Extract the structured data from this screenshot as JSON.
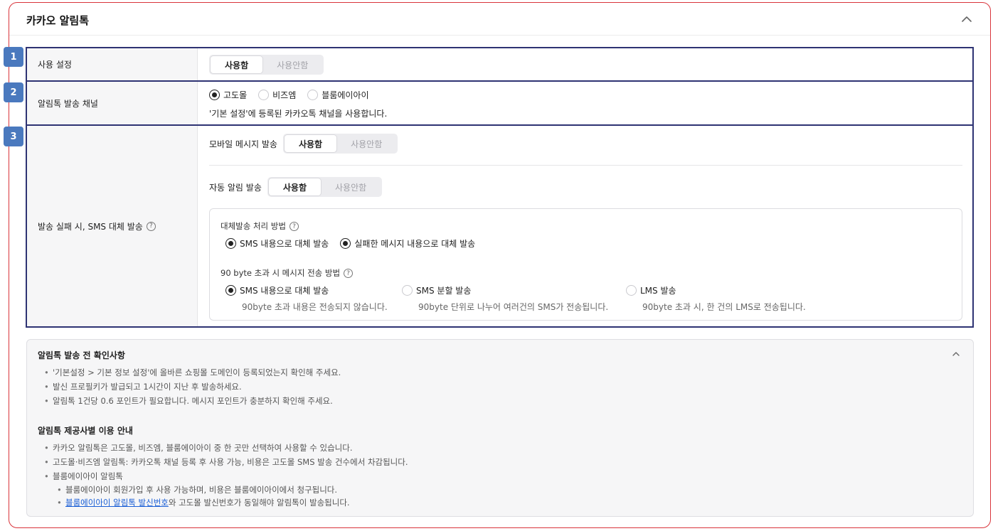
{
  "panel": {
    "title": "카카오 알림톡"
  },
  "badges": [
    "1",
    "2",
    "3"
  ],
  "rows": {
    "usage": {
      "label": "사용 설정",
      "options": [
        "사용함",
        "사용안함"
      ],
      "selected": 0
    },
    "channel": {
      "label": "알림톡 발송 채널",
      "options": [
        "고도몰",
        "비즈엠",
        "블룸에이아이"
      ],
      "selected": 0,
      "description": "'기본 설정'에 등록된 카카오톡 채널을 사용합니다."
    },
    "fallback": {
      "label": "발송 실패 시, SMS 대체 발송",
      "mobile_label": "모바일 메시지 발송",
      "mobile_options": [
        "사용함",
        "사용안함"
      ],
      "auto_label": "자동 알림 발송",
      "auto_options": [
        "사용함",
        "사용안함"
      ],
      "method_title": "대체발송 처리 방법",
      "method_options": [
        "SMS 내용으로 대체 발송",
        "실패한 메시지 내용으로 대체 발송"
      ],
      "over90_title": "90 byte 초과 시 메시지 전송 방법",
      "over90_options": [
        {
          "label": "SMS 내용으로 대체 발송",
          "desc": "90byte 초과 내용은 전송되지 않습니다."
        },
        {
          "label": "SMS 분할 발송",
          "desc": "90byte 단위로 나누어 여러건의 SMS가 전송됩니다."
        },
        {
          "label": "LMS 발송",
          "desc": "90byte 초과 시, 한 건의 LMS로 전송됩니다."
        }
      ]
    }
  },
  "info": {
    "section1_title": "알림톡 발송 전 확인사항",
    "section1_items": [
      "'기본설정 > 기본 정보 설정'에 올바른 쇼핑몰 도메인이 등록되었는지 확인해 주세요.",
      "발신 프로필키가 발급되고 1시간이 지난 후 발송하세요.",
      "알림톡 1건당 0.6 포인트가 필요합니다. 메시지 포인트가 충분하지 확인해 주세요."
    ],
    "section2_title": "알림톡 제공사별 이용 안내",
    "section2_items": [
      "카카오 알림톡은 고도몰, 비즈엠, 블룸에이아이 중 한 곳만 선택하여 사용할 수 있습니다.",
      "고도몰·비즈엠 알림톡: 카카오톡 채널 등록 후 사용 가능, 비용은 고도몰 SMS 발송 건수에서 차감됩니다.",
      "블룸에이아이 알림톡"
    ],
    "sub_item1": "블룸에이아이 회원가입 후 사용 가능하며, 비용은 블룸에이아이에서 청구됩니다.",
    "sub_item2_link": "블룸에이아이 알림톡 발신번호",
    "sub_item2_rest": "와 고도몰 발신번호가 동일해야 알림톡이 발송됩니다."
  }
}
